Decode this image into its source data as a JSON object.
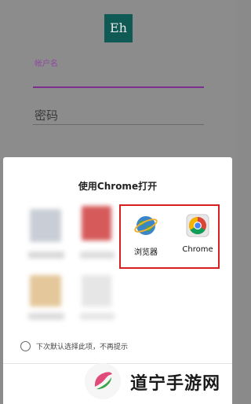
{
  "login": {
    "logo_text": "Eh",
    "username_label": "帐户名",
    "password_label": "密码"
  },
  "chooser": {
    "title": "使用Chrome打开",
    "apps": [
      {
        "label": "浏览器",
        "icon": "browser-globe-icon"
      },
      {
        "label": "Chrome",
        "icon": "chrome-icon"
      }
    ],
    "remember_choice": "下次默认选择此项，不再提示"
  },
  "watermark": {
    "text": "道宁手游网"
  },
  "colors": {
    "highlight": "#d81e1e",
    "logo_bg": "#0f5a55",
    "username_underline": "#7c2f8c"
  }
}
